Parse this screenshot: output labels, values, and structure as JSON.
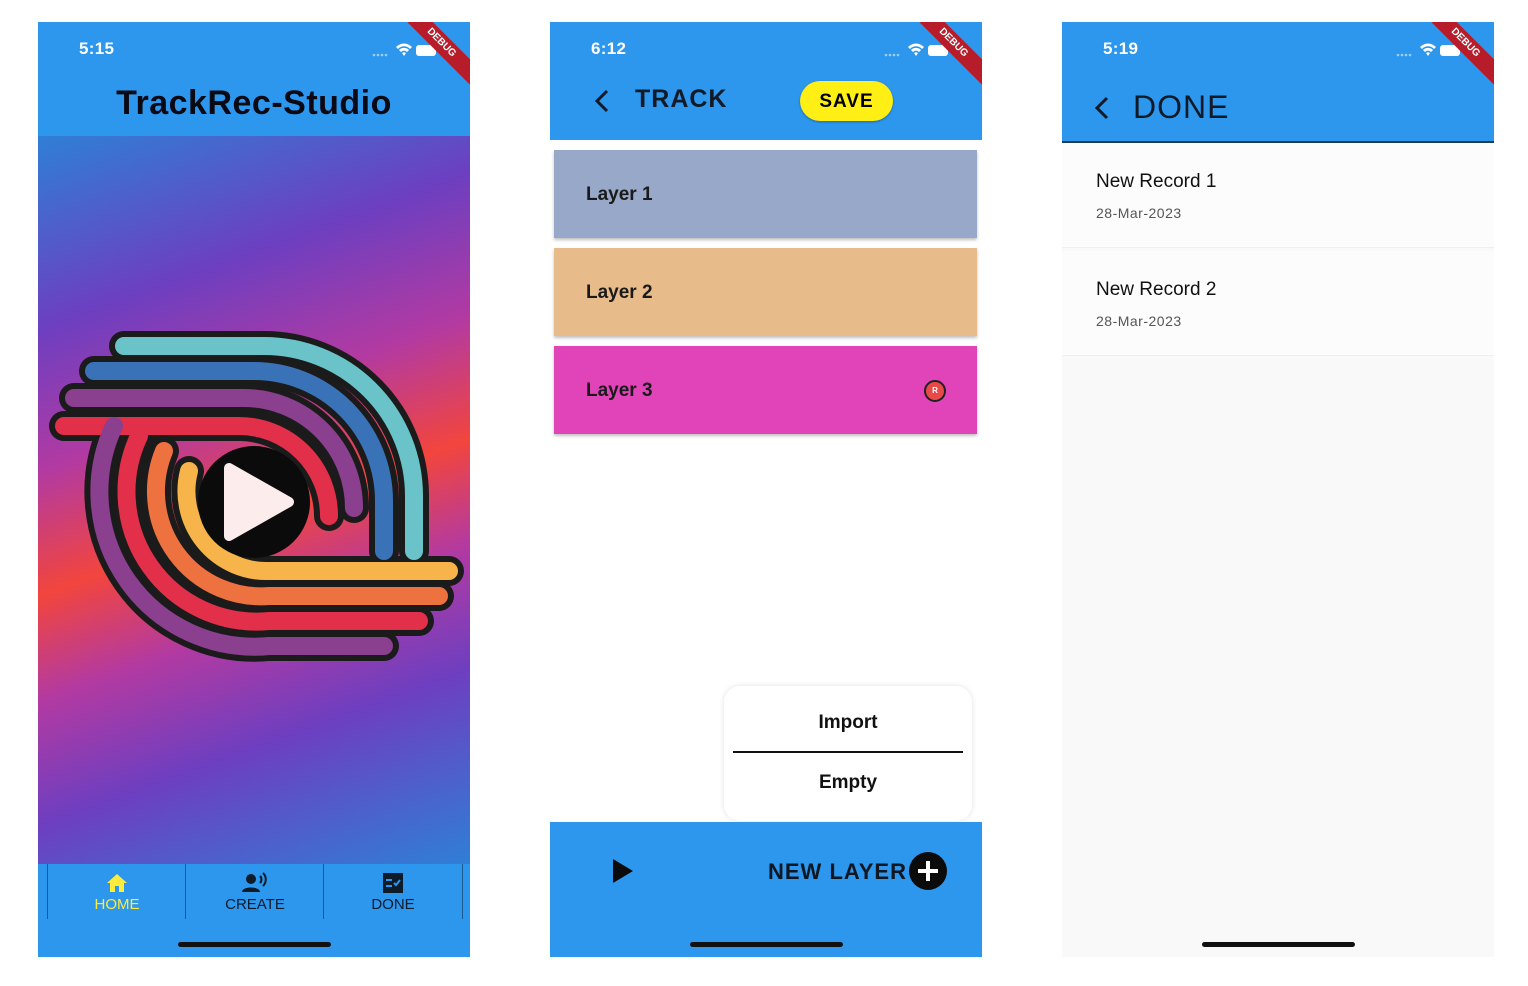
{
  "screens": {
    "home": {
      "status_time": "5:15",
      "debug_label": "DEBUG",
      "title": "TrackRec-Studio",
      "nav": [
        {
          "label": "HOME",
          "icon": "home-icon",
          "active": true
        },
        {
          "label": "CREATE",
          "icon": "record-voice-icon",
          "active": false
        },
        {
          "label": "DONE",
          "icon": "done-list-icon",
          "active": false
        }
      ]
    },
    "track": {
      "status_time": "6:12",
      "debug_label": "DEBUG",
      "title": "TRACK",
      "save_label": "SAVE",
      "layers": [
        {
          "name": "Layer 1",
          "color": "#98a8c8"
        },
        {
          "name": "Layer 2",
          "color": "#e8bb8a"
        },
        {
          "name": "Layer 3",
          "color": "#e044b8",
          "recording_badge": "R"
        }
      ],
      "popup": {
        "import_label": "Import",
        "empty_label": "Empty"
      },
      "new_layer_label": "NEW LAYER"
    },
    "done": {
      "status_time": "5:19",
      "debug_label": "DEBUG",
      "title": "DONE",
      "records": [
        {
          "name": "New Record 1",
          "date": "28-Mar-2023"
        },
        {
          "name": "New Record 2",
          "date": "28-Mar-2023"
        }
      ]
    }
  },
  "colors": {
    "appbar": "#2d96ed",
    "save_button": "#ffef15",
    "nav_active": "#ffeb3b",
    "debug_banner": "#b71c2b"
  }
}
